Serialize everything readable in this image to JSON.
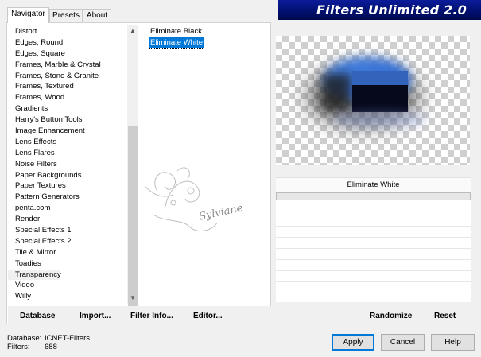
{
  "banner": {
    "title": "Filters Unlimited 2.0"
  },
  "tabs": [
    {
      "label": "Navigator",
      "active": true
    },
    {
      "label": "Presets",
      "active": false
    },
    {
      "label": "About",
      "active": false
    }
  ],
  "categories": [
    "Distort",
    "Edges, Round",
    "Edges, Square",
    "Frames, Marble & Crystal",
    "Frames, Stone & Granite",
    "Frames, Textured",
    "Frames, Wood",
    "Gradients",
    "Harry's Button Tools",
    "Image Enhancement",
    "Lens Effects",
    "Lens Flares",
    "Noise Filters",
    "Paper Backgrounds",
    "Paper Textures",
    "Pattern Generators",
    "penta.com",
    "Render",
    "Special Effects 1",
    "Special Effects 2",
    "Tile & Mirror",
    "Toadies",
    "Transparency",
    "Video",
    "Willy"
  ],
  "selected_category": "Transparency",
  "filters": [
    "Eliminate Black",
    "Eliminate White"
  ],
  "selected_filter": "Eliminate White",
  "watermark": {
    "text": "Sylviane"
  },
  "preview": {
    "filter_name": "Eliminate White"
  },
  "left_buttons": {
    "database": "Database",
    "import": "Import...",
    "filter_info": "Filter Info...",
    "editor": "Editor..."
  },
  "right_buttons": {
    "randomize": "Randomize",
    "reset": "Reset"
  },
  "info": {
    "database_label": "Database:",
    "database_value": "ICNET-Filters",
    "filters_label": "Filters:",
    "filters_value": "688"
  },
  "dialog_buttons": {
    "apply": "Apply",
    "cancel": "Cancel",
    "help": "Help"
  },
  "colors": {
    "banner": "#001070",
    "selection": "#0078d7",
    "primary_border": "#0078d7"
  }
}
